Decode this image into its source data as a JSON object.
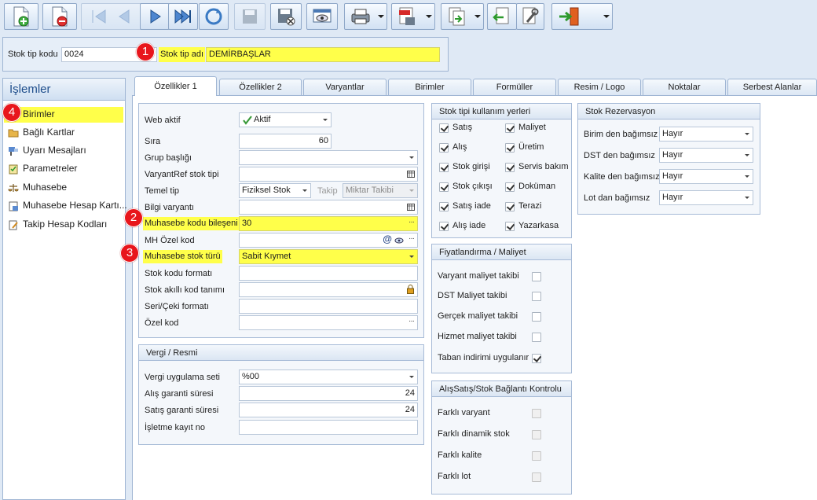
{
  "header": {
    "stock_code_label": "Stok tip kodu",
    "stock_code_value": "0024",
    "stock_name_label": "Stok tip adı",
    "stock_name_value": "DEMİRBAŞLAR"
  },
  "callouts": [
    "1",
    "2",
    "3",
    "4"
  ],
  "left_panel": {
    "title": "İşlemler",
    "items": [
      {
        "label": "Birimler",
        "icon": "units-icon"
      },
      {
        "label": "Bağlı Kartlar",
        "icon": "folder-icon"
      },
      {
        "label": "Uyarı Mesajları",
        "icon": "warning-icon"
      },
      {
        "label": "Parametreler",
        "icon": "parameters-icon"
      },
      {
        "label": "Muhasebe",
        "icon": "scale-icon"
      },
      {
        "label": "Muhasebe Hesap Kartı...",
        "icon": "account-card-icon"
      },
      {
        "label": "Takip Hesap Kodları",
        "icon": "tracking-icon"
      }
    ]
  },
  "tabs": [
    "Özellikler 1",
    "Özellikler 2",
    "Varyantlar",
    "Birimler",
    "Formüller",
    "Resim / Logo",
    "Noktalar",
    "Serbest Alanlar"
  ],
  "properties": {
    "web_active_label": "Web aktif",
    "web_active_value": "Aktif",
    "order_label": "Sıra",
    "order_value": "60",
    "group_header_label": "Grup başlığı",
    "variantref_label": "VaryantRef stok tipi",
    "base_type_label": "Temel tip",
    "base_type_value": "Fiziksel Stok",
    "track_label": "Takip",
    "track_value": "Miktar Takibi",
    "info_variant_label": "Bilgi varyantı",
    "acc_code_component_label": "Muhasebe kodu bileşeni",
    "acc_code_component_value": "30",
    "mh_special_code_label": "MH Özel kod",
    "acc_stock_type_label": "Muhasebe stok türü",
    "acc_stock_type_value": "Sabit Kıymet",
    "stock_code_format_label": "Stok kodu formatı",
    "smart_code_label": "Stok akıllı kod tanımı",
    "serial_format_label": "Seri/Çeki formatı",
    "special_code_label": "Özel kod"
  },
  "tax": {
    "title": "Vergi / Resmi",
    "tax_set_label": "Vergi uygulama seti",
    "tax_set_value": "%00",
    "purchase_warranty_label": "Alış garanti süresi",
    "purchase_warranty_value": "24",
    "sales_warranty_label": "Satış garanti süresi",
    "sales_warranty_value": "24",
    "business_record_label": "İşletme kayıt no"
  },
  "usage": {
    "title": "Stok tipi kullanım yerleri",
    "items": [
      {
        "label": "Satış",
        "checked": true
      },
      {
        "label": "Maliyet",
        "checked": true
      },
      {
        "label": "Alış",
        "checked": true
      },
      {
        "label": "Üretim",
        "checked": true
      },
      {
        "label": "Stok girişi",
        "checked": true
      },
      {
        "label": "Servis bakım",
        "checked": true
      },
      {
        "label": "Stok çıkışı",
        "checked": true
      },
      {
        "label": "Doküman",
        "checked": true
      },
      {
        "label": "Satış iade",
        "checked": true
      },
      {
        "label": "Terazi",
        "checked": true
      },
      {
        "label": "Alış iade",
        "checked": true
      },
      {
        "label": "Yazarkasa",
        "checked": true
      }
    ]
  },
  "pricing": {
    "title": "Fiyatlandırma / Maliyet",
    "items": [
      {
        "label": "Varyant maliyet takibi",
        "checked": false
      },
      {
        "label": "DST Maliyet takibi",
        "checked": false
      },
      {
        "label": "Gerçek maliyet takibi",
        "checked": false
      },
      {
        "label": "Hizmet maliyet takibi",
        "checked": false
      },
      {
        "label": "Taban indirimi uygulanır",
        "checked": true
      }
    ]
  },
  "link_control": {
    "title": "AlışSatış/Stok Bağlantı Kontrolu",
    "items": [
      {
        "label": "Farklı varyant",
        "checked": false
      },
      {
        "label": "Farklı dinamik stok",
        "checked": false
      },
      {
        "label": "Farklı kalite",
        "checked": false
      },
      {
        "label": "Farklı lot",
        "checked": false
      }
    ]
  },
  "reservation": {
    "title": "Stok Rezervasyon",
    "items": [
      {
        "label": "Birim den bağımsız",
        "value": "Hayır"
      },
      {
        "label": "DST den bağımsız",
        "value": "Hayır"
      },
      {
        "label": "Kalite den bağımsız",
        "value": "Hayır"
      },
      {
        "label": "Lot dan bağımsız",
        "value": "Hayır"
      }
    ]
  }
}
